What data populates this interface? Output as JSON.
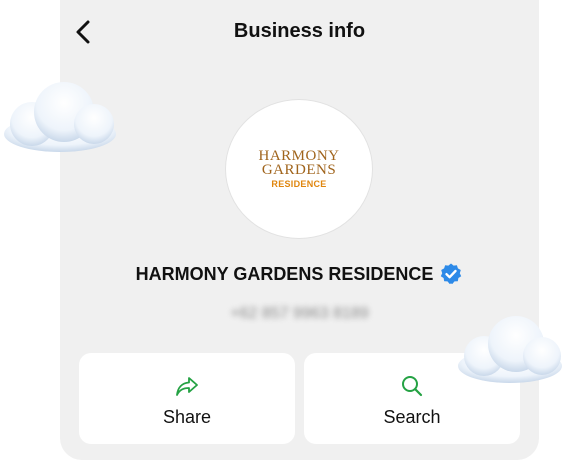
{
  "header": {
    "title": "Business info"
  },
  "logo": {
    "line1": "HARMONY",
    "line2": "GARDENS",
    "line3": "RESIDENCE"
  },
  "business": {
    "name": "HARMONY GARDENS RESIDENCE",
    "phone": "+62 857 9963 8189"
  },
  "actions": [
    {
      "label": "Share",
      "icon": "share-icon"
    },
    {
      "label": "Search",
      "icon": "search-icon"
    }
  ],
  "colors": {
    "accent": "#25a244",
    "verified": "#2d8ae8",
    "logo_brown": "#a0641c",
    "logo_orange": "#e0860e",
    "card_bg": "#f0f0f0"
  }
}
